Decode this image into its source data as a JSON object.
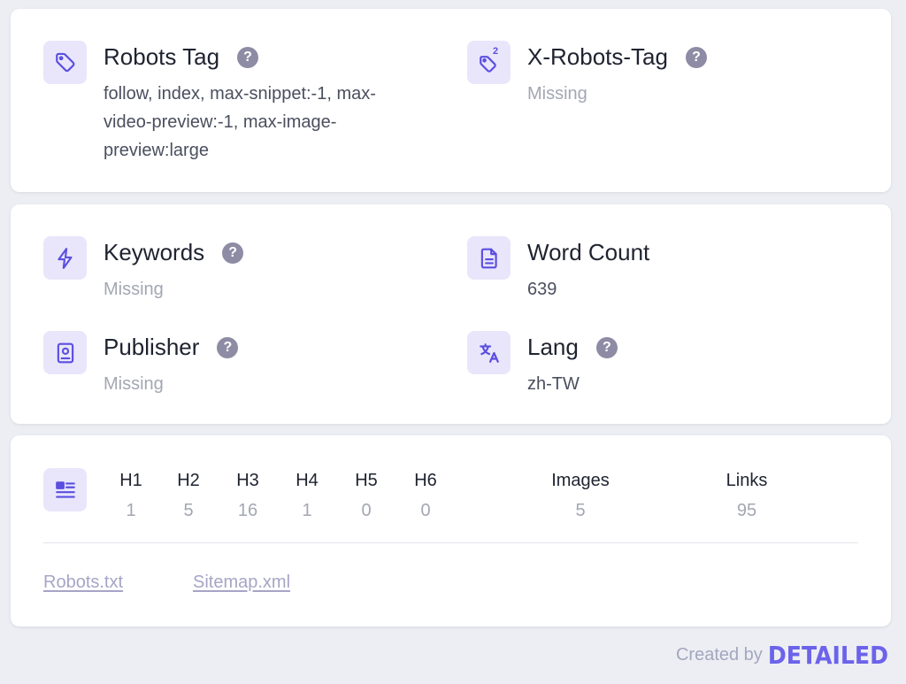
{
  "colors": {
    "accent": "#5b4fe0",
    "icon_bg": "#e9e6fb",
    "help_bg": "#8e8ba5",
    "muted": "#a3a7b3"
  },
  "meta": {
    "robots_tag": {
      "title": "Robots Tag",
      "value": "follow, index, max-snippet:-1, max-video-preview:-1, max-image-preview:large",
      "icon": "tag-icon"
    },
    "x_robots_tag": {
      "title": "X-Robots-Tag",
      "value": "Missing",
      "icon": "tag-superscript-icon",
      "icon_badge": "2"
    },
    "keywords": {
      "title": "Keywords",
      "value": "Missing",
      "icon": "bolt-icon"
    },
    "word_count": {
      "title": "Word Count",
      "value": "639",
      "icon": "document-icon"
    },
    "publisher": {
      "title": "Publisher",
      "value": "Missing",
      "icon": "contact-card-icon"
    },
    "lang": {
      "title": "Lang",
      "value": "zh-TW",
      "icon": "translate-icon"
    },
    "help_glyph": "?"
  },
  "stats": {
    "icon": "headings-list-icon",
    "items": [
      {
        "label": "H1",
        "value": "1"
      },
      {
        "label": "H2",
        "value": "5"
      },
      {
        "label": "H3",
        "value": "16"
      },
      {
        "label": "H4",
        "value": "1"
      },
      {
        "label": "H5",
        "value": "0"
      },
      {
        "label": "H6",
        "value": "0"
      },
      {
        "label": "Images",
        "value": "5"
      },
      {
        "label": "Links",
        "value": "95"
      }
    ]
  },
  "links": {
    "robots_txt": "Robots.txt",
    "sitemap_xml": "Sitemap.xml"
  },
  "footer": {
    "created_by": "Created by",
    "brand": "DETAILED"
  }
}
